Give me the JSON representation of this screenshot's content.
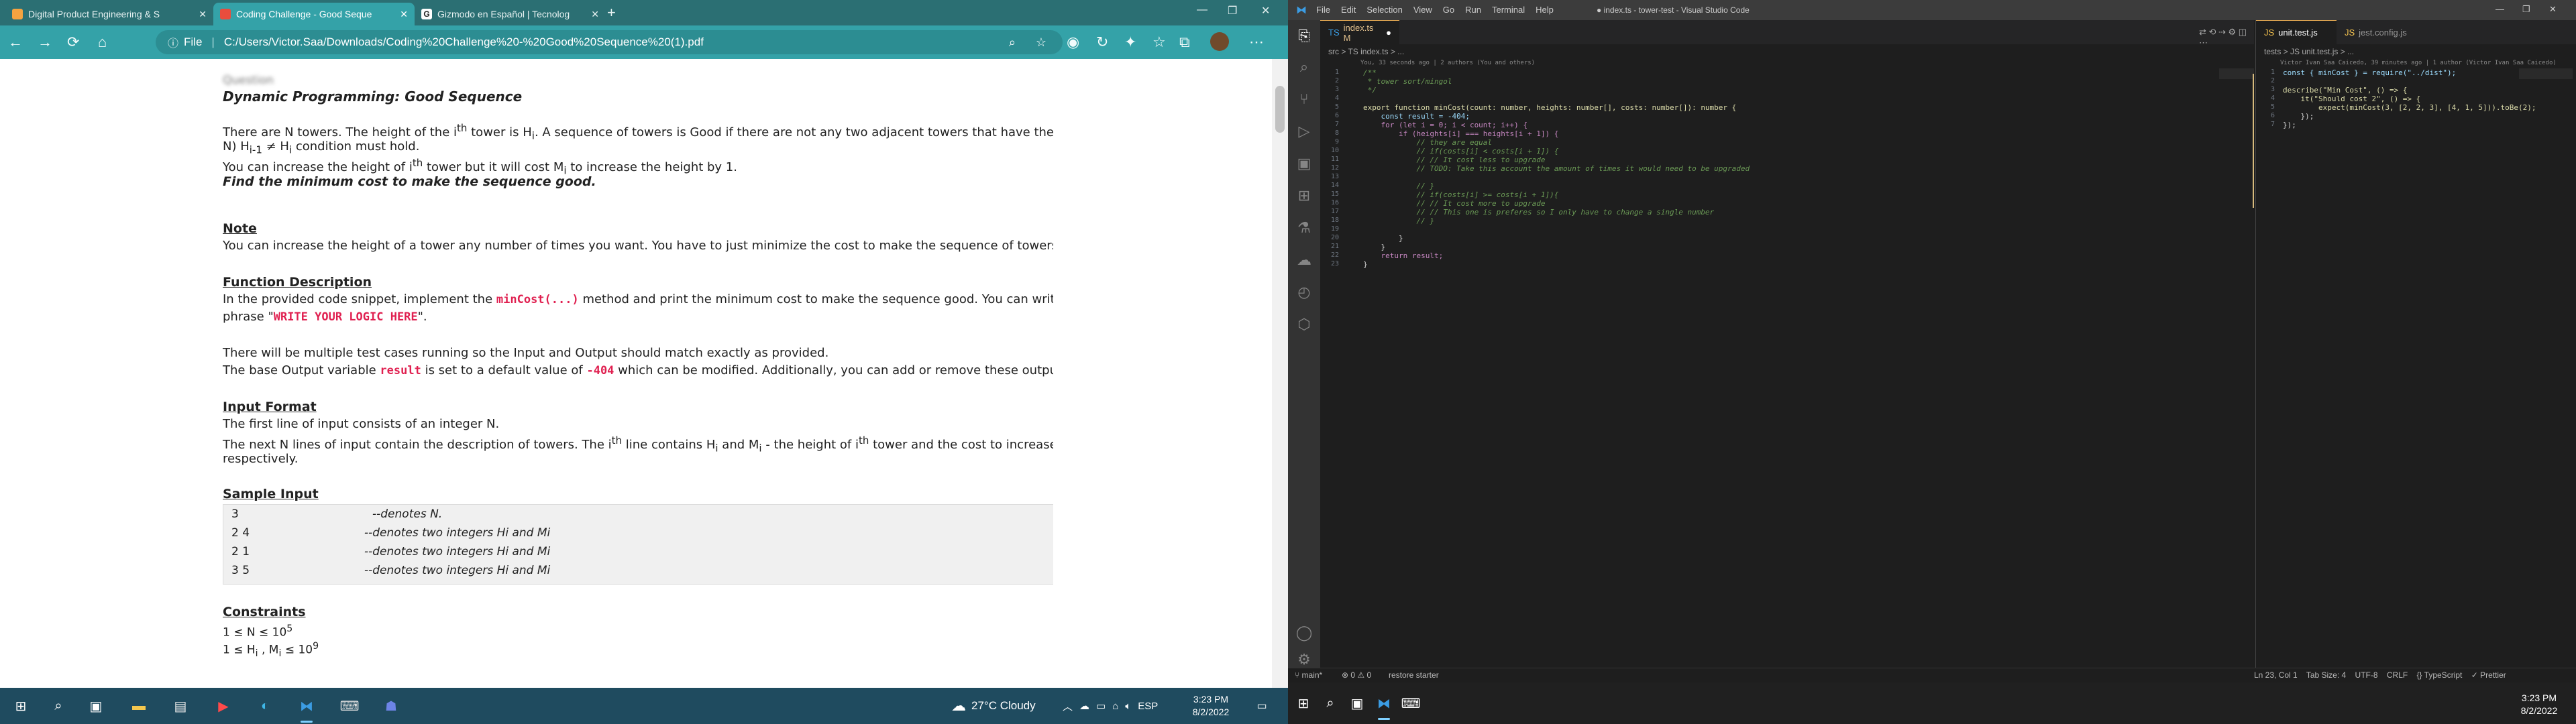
{
  "browser": {
    "tabs": [
      {
        "title": "Digital Product Engineering & S",
        "favicon_color": "#f4a340"
      },
      {
        "title": "Coding Challenge - Good Seque",
        "favicon_color": "#e84d3d"
      },
      {
        "title": "Gizmodo en Español | Tecnolog",
        "favicon_color": "#222222"
      }
    ],
    "address_prefix": "File",
    "address": "C:/Users/Victor.Saa/Downloads/Coding%20Challenge%20-%20Good%20Sequence%20(1).pdf"
  },
  "doc": {
    "heading_blur": "Question",
    "title": "Dynamic Programming: Good Sequence",
    "p1a": "There are N towers. The height of the i",
    "p1b": "th",
    "p1c": " tower is H",
    "p1d": "i",
    "p1e": ". A sequence of towers is Good if there are not any two adjacent towers that have the same",
    "p2a": "N) H",
    "p2b": "i-1",
    "p2c": " ≠ H",
    "p2d": "i",
    "p2e": " condition must hold.",
    "p3a": "You can increase the height of i",
    "p3b": "th",
    "p3c": " tower but it will cost M",
    "p3d": "i",
    "p3e": " to increase the height by 1.",
    "p4": "Find the minimum cost to make the sequence good.",
    "note_h": "Note",
    "note": "You can increase the height of a tower any number of times you want. You have to just minimize the cost to make the sequence of towers Good",
    "func_h": "Function Description",
    "func1a": "In the provided code snippet, implement the ",
    "func1b": "minCost(...)",
    "func1c": " method and print the minimum cost to make the sequence good. You can write co",
    "func2a": "phrase \"",
    "func2b": "WRITE YOUR LOGIC HERE",
    "func2c": "\".",
    "tests": "There will be multiple test cases running so the Input and Output should match exactly as provided.",
    "base_a": "The base Output variable ",
    "base_b": "result",
    "base_c": " is set to a default value of ",
    "base_d": "-404",
    "base_e": " which can be modified. Additionally, you can add or remove these output varia",
    "input_h": "Input Format",
    "in1": "The first line of input consists of an integer N.",
    "in2a": "The next N lines of input contain the description of towers. The i",
    "in2b": "th",
    "in2c": " line contains H",
    "in2d": "i",
    "in2e": " and M",
    "in2f": "i",
    "in2g": " - the height of i",
    "in2h": "th",
    "in2i": " tower and the cost to increase the h",
    "in3": "respectively.",
    "sample_h": "Sample Input",
    "sample": [
      {
        "v": "3",
        "c": "--denotes N."
      },
      {
        "v": "2 4",
        "c": "--denotes two integers Hi and Mi"
      },
      {
        "v": "2 1",
        "c": "--denotes two integers Hi and Mi"
      },
      {
        "v": "3 5",
        "c": "--denotes two integers Hi and Mi"
      }
    ],
    "cons_h": "Constraints",
    "c1": "1 ≤ N ≤ 10",
    "c1s": "5",
    "c2": "1 ≤ H",
    "c2s": "i",
    "c2b": " , M",
    "c2t": "i",
    "c2c": " ≤ 10",
    "c2e": "9"
  },
  "taskbar_left": {
    "weather": "27°C  Cloudy",
    "lang": "ESP",
    "time": "3:23 PM",
    "date": "8/2/2022"
  },
  "vscode": {
    "menu": [
      "File",
      "Edit",
      "Selection",
      "View",
      "Go",
      "Run",
      "Terminal",
      "Help"
    ],
    "title": "● index.ts - tower-test - Visual Studio Code",
    "left_tab": "index.ts  M",
    "crumb": "src  >  TS index.ts  >  ...",
    "blame": "You, 33 seconds ago | 2 authors (You and others)",
    "right_tabs": [
      "unit.test.js",
      "jest.config.js"
    ],
    "right_crumb": "tests  >  JS unit.test.js  >  ...",
    "right_blame": "Victor Ivan Saa Caicedo, 39 minutes ago | 1 author (Victor Ivan Saa Caicedo)",
    "status_left": "main*",
    "status_sync": "⊗ 0 ⚠ 0",
    "status_server": "restore starter",
    "status_right": "Ln 23, Col 1    Tab Size: 4    UTF-8    CRLF    {} TypeScript    ✓ Prettier",
    "time": "3:23 PM",
    "date": "8/2/2022"
  },
  "code_left": [
    {
      "n": "1",
      "t": "/**",
      "cls": "cm"
    },
    {
      "n": "2",
      "t": " * tower sort/mingol",
      "cls": "cm"
    },
    {
      "n": "3",
      "t": " */",
      "cls": "cm"
    },
    {
      "n": "4",
      "t": "",
      "cls": "pl"
    },
    {
      "n": "5",
      "t": "export function minCost(count: number, heights: number[], costs: number[]): number {",
      "cls": "fn"
    },
    {
      "n": "6",
      "t": "    const result = -404;",
      "cls": "vr"
    },
    {
      "n": "7",
      "t": "    for (let i = 0; i < count; i++) {",
      "cls": "cl"
    },
    {
      "n": "8",
      "t": "        if (heights[i] === heights[i + 1]) {",
      "cls": "cl"
    },
    {
      "n": "9",
      "t": "            // they are equal",
      "cls": "cm"
    },
    {
      "n": "10",
      "t": "            // if(costs[i] < costs[i + 1]) {",
      "cls": "cm"
    },
    {
      "n": "11",
      "t": "            // // It cost less to upgrade",
      "cls": "cm"
    },
    {
      "n": "12",
      "t": "            // TODO: Take this account the amount of times it would need to be upgraded",
      "cls": "cm"
    },
    {
      "n": "13",
      "t": "",
      "cls": "pl"
    },
    {
      "n": "14",
      "t": "            // }",
      "cls": "cm"
    },
    {
      "n": "15",
      "t": "            // if(costs[i] >= costs[i + 1]){",
      "cls": "cm"
    },
    {
      "n": "16",
      "t": "            // // It cost more to upgrade",
      "cls": "cm"
    },
    {
      "n": "17",
      "t": "            // // This one is preferes so I only have to change a single number",
      "cls": "cm"
    },
    {
      "n": "18",
      "t": "            // }",
      "cls": "cm"
    },
    {
      "n": "19",
      "t": "",
      "cls": "pl"
    },
    {
      "n": "20",
      "t": "        }",
      "cls": "pl"
    },
    {
      "n": "21",
      "t": "    }",
      "cls": "pl"
    },
    {
      "n": "22",
      "t": "    return result;",
      "cls": "cl"
    },
    {
      "n": "23",
      "t": "}",
      "cls": "pl"
    }
  ],
  "code_right": [
    {
      "n": "1",
      "t": "const { minCost } = require(\"../dist\");",
      "cls": "vr"
    },
    {
      "n": "2",
      "t": "",
      "cls": "pl"
    },
    {
      "n": "3",
      "t": "describe(\"Min Cost\", () => {",
      "cls": "fn"
    },
    {
      "n": "4",
      "t": "    it(\"Should cost 2\", () => {",
      "cls": "fn"
    },
    {
      "n": "5",
      "t": "        expect(minCost(3, [2, 2, 3], [4, 1, 5])).toBe(2);",
      "cls": "fn"
    },
    {
      "n": "6",
      "t": "    });",
      "cls": "pl"
    },
    {
      "n": "7",
      "t": "});",
      "cls": "pl"
    }
  ]
}
